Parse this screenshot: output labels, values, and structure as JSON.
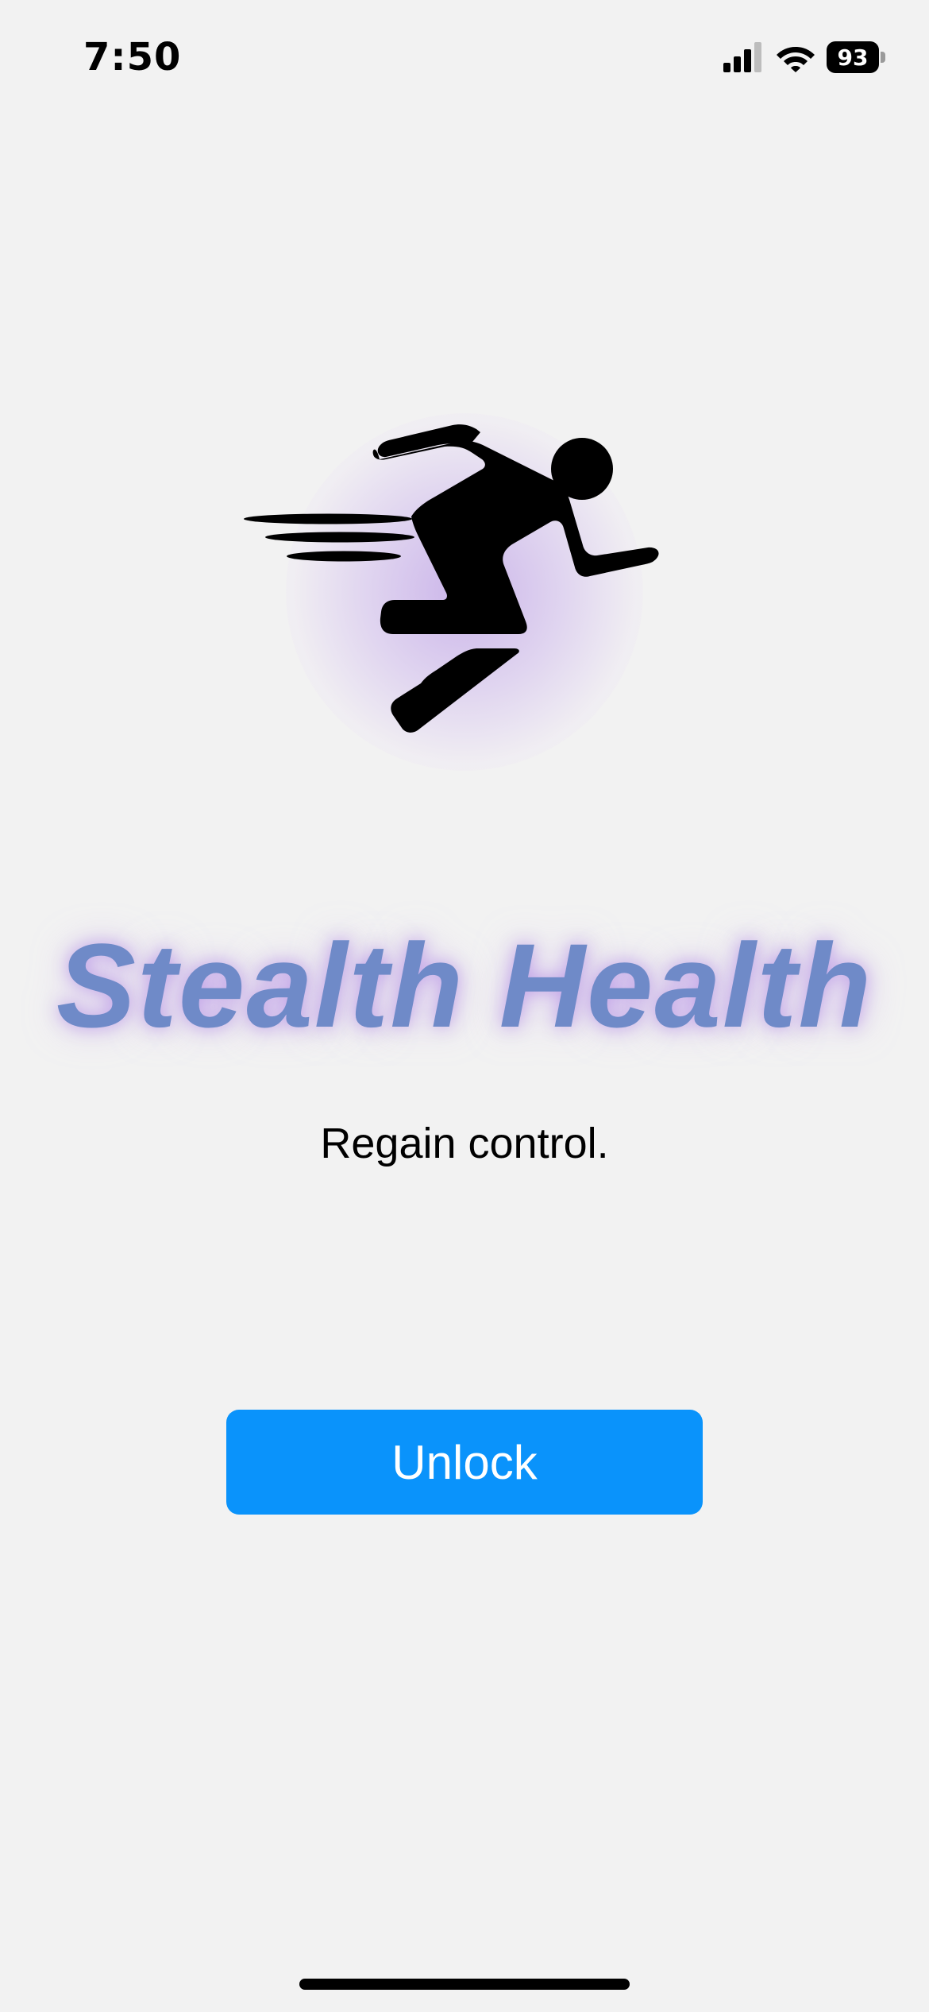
{
  "status_bar": {
    "time": "7:50",
    "battery_level": "93",
    "icons": [
      "cellular-signal-icon",
      "wifi-icon",
      "battery-icon"
    ]
  },
  "hero": {
    "icon": "running-person-icon"
  },
  "app": {
    "title": "Stealth Health",
    "tagline": "Regain control."
  },
  "actions": {
    "unlock_label": "Unlock"
  },
  "colors": {
    "background": "#f2f2f2",
    "title": "#6f8ac8",
    "title_glow": "#ba96e6",
    "button": "#0a93fb",
    "button_text": "#ffffff"
  }
}
